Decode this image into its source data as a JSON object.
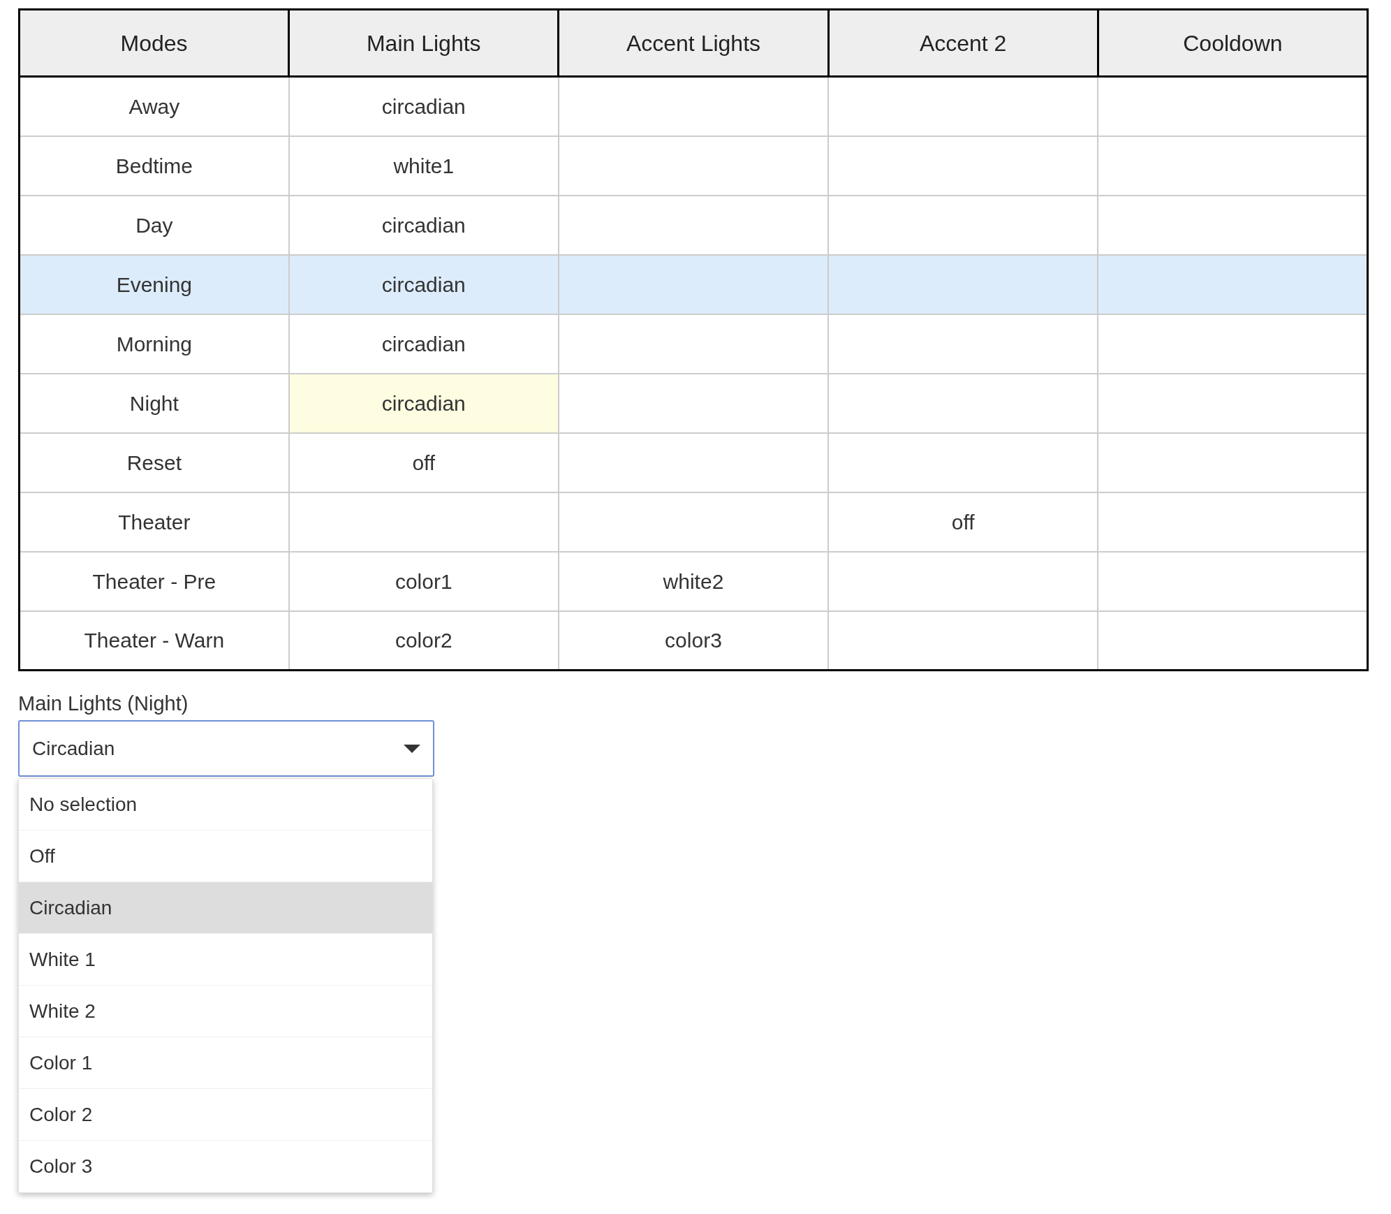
{
  "table": {
    "columns": [
      "Modes",
      "Main Lights",
      "Accent Lights",
      "Accent 2",
      "Cooldown"
    ],
    "rows": [
      {
        "hovered": false,
        "cells": [
          {
            "text": "Away",
            "selected": false
          },
          {
            "text": "circadian",
            "selected": false
          },
          {
            "text": "",
            "selected": false
          },
          {
            "text": "",
            "selected": false
          },
          {
            "text": "",
            "selected": false
          }
        ]
      },
      {
        "hovered": false,
        "cells": [
          {
            "text": "Bedtime",
            "selected": false
          },
          {
            "text": "white1",
            "selected": false
          },
          {
            "text": "",
            "selected": false
          },
          {
            "text": "",
            "selected": false
          },
          {
            "text": "",
            "selected": false
          }
        ]
      },
      {
        "hovered": false,
        "cells": [
          {
            "text": "Day",
            "selected": false
          },
          {
            "text": "circadian",
            "selected": false
          },
          {
            "text": "",
            "selected": false
          },
          {
            "text": "",
            "selected": false
          },
          {
            "text": "",
            "selected": false
          }
        ]
      },
      {
        "hovered": true,
        "cells": [
          {
            "text": "Evening",
            "selected": false
          },
          {
            "text": "circadian",
            "selected": false
          },
          {
            "text": "",
            "selected": false
          },
          {
            "text": "",
            "selected": false
          },
          {
            "text": "",
            "selected": false
          }
        ]
      },
      {
        "hovered": false,
        "cells": [
          {
            "text": "Morning",
            "selected": false
          },
          {
            "text": "circadian",
            "selected": false
          },
          {
            "text": "",
            "selected": false
          },
          {
            "text": "",
            "selected": false
          },
          {
            "text": "",
            "selected": false
          }
        ]
      },
      {
        "hovered": false,
        "cells": [
          {
            "text": "Night",
            "selected": false
          },
          {
            "text": "circadian",
            "selected": true
          },
          {
            "text": "",
            "selected": false
          },
          {
            "text": "",
            "selected": false
          },
          {
            "text": "",
            "selected": false
          }
        ]
      },
      {
        "hovered": false,
        "cells": [
          {
            "text": "Reset",
            "selected": false
          },
          {
            "text": "off",
            "selected": false
          },
          {
            "text": "",
            "selected": false
          },
          {
            "text": "",
            "selected": false
          },
          {
            "text": "",
            "selected": false
          }
        ]
      },
      {
        "hovered": false,
        "cells": [
          {
            "text": "Theater",
            "selected": false
          },
          {
            "text": "",
            "selected": false
          },
          {
            "text": "",
            "selected": false
          },
          {
            "text": "off",
            "selected": false
          },
          {
            "text": "",
            "selected": false
          }
        ]
      },
      {
        "hovered": false,
        "cells": [
          {
            "text": "Theater - Pre",
            "selected": false
          },
          {
            "text": "color1",
            "selected": false
          },
          {
            "text": "white2",
            "selected": false
          },
          {
            "text": "",
            "selected": false
          },
          {
            "text": "",
            "selected": false
          }
        ]
      },
      {
        "hovered": false,
        "cells": [
          {
            "text": "Theater - Warn",
            "selected": false
          },
          {
            "text": "color2",
            "selected": false
          },
          {
            "text": "color3",
            "selected": false
          },
          {
            "text": "",
            "selected": false
          },
          {
            "text": "",
            "selected": false
          }
        ]
      }
    ]
  },
  "select": {
    "label": "Main Lights (Night)",
    "value": "Circadian",
    "expanded": true,
    "options": [
      {
        "label": "No selection",
        "selected": false
      },
      {
        "label": "Off",
        "selected": false
      },
      {
        "label": "Circadian",
        "selected": true
      },
      {
        "label": "White 1",
        "selected": false
      },
      {
        "label": "White 2",
        "selected": false
      },
      {
        "label": "Color 1",
        "selected": false
      },
      {
        "label": "Color 2",
        "selected": false
      },
      {
        "label": "Color 3",
        "selected": false
      }
    ]
  }
}
